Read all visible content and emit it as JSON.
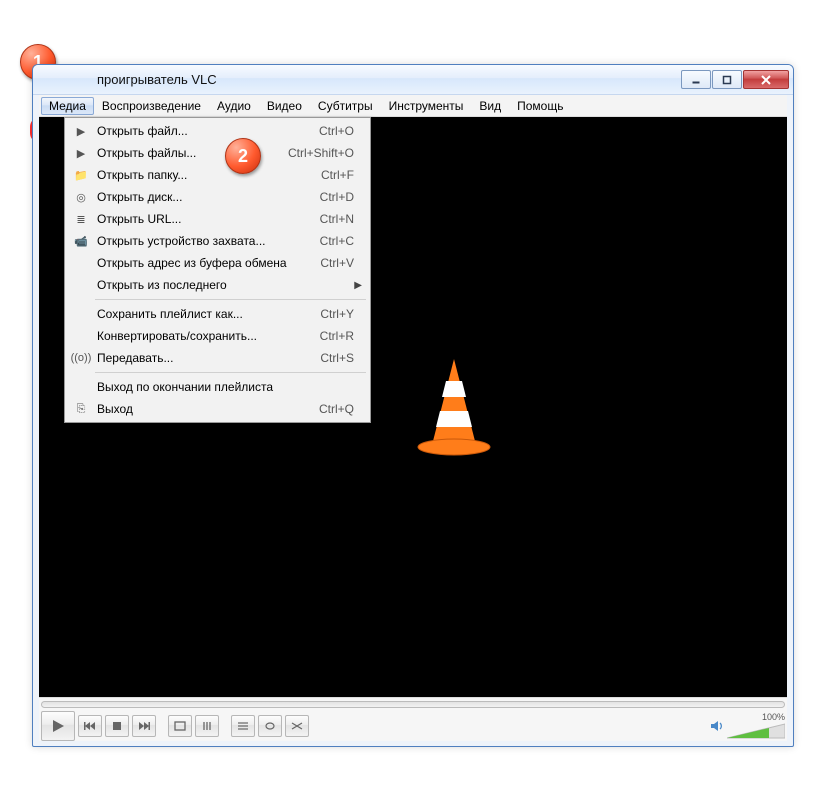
{
  "window_title": "проигрыватель VLC",
  "menubar": [
    "Медиа",
    "Воспроизведение",
    "Аудио",
    "Видео",
    "Субтитры",
    "Инструменты",
    "Вид",
    "Помощь"
  ],
  "active_menu": 0,
  "dropdown": {
    "groups": [
      [
        {
          "icon": "▶",
          "label": "Открыть файл...",
          "shortcut": "Ctrl+O",
          "sub": false,
          "highlight": true
        },
        {
          "icon": "▶",
          "label": "Открыть файлы...",
          "shortcut": "Ctrl+Shift+O",
          "sub": false
        },
        {
          "icon": "📁",
          "label": "Открыть папку...",
          "shortcut": "Ctrl+F",
          "sub": false
        },
        {
          "icon": "◎",
          "label": "Открыть диск...",
          "shortcut": "Ctrl+D",
          "sub": false
        },
        {
          "icon": "≣",
          "label": "Открыть URL...",
          "shortcut": "Ctrl+N",
          "sub": false
        },
        {
          "icon": "📹",
          "label": "Открыть устройство захвата...",
          "shortcut": "Ctrl+C",
          "sub": false
        },
        {
          "icon": "",
          "label": "Открыть адрес из буфера обмена",
          "shortcut": "Ctrl+V",
          "sub": false
        },
        {
          "icon": "",
          "label": "Открыть из последнего",
          "shortcut": "",
          "sub": true
        }
      ],
      [
        {
          "icon": "",
          "label": "Сохранить плейлист как...",
          "shortcut": "Ctrl+Y",
          "sub": false
        },
        {
          "icon": "",
          "label": "Конвертировать/сохранить...",
          "shortcut": "Ctrl+R",
          "sub": false
        },
        {
          "icon": "((o))",
          "label": "Передавать...",
          "shortcut": "Ctrl+S",
          "sub": false
        }
      ],
      [
        {
          "icon": "",
          "label": "Выход по окончании плейлиста",
          "shortcut": "",
          "sub": false
        },
        {
          "icon": "⎘",
          "label": "Выход",
          "shortcut": "Ctrl+Q",
          "sub": false
        }
      ]
    ]
  },
  "volume_pct": "100%",
  "callouts": {
    "one": "1",
    "two": "2"
  }
}
